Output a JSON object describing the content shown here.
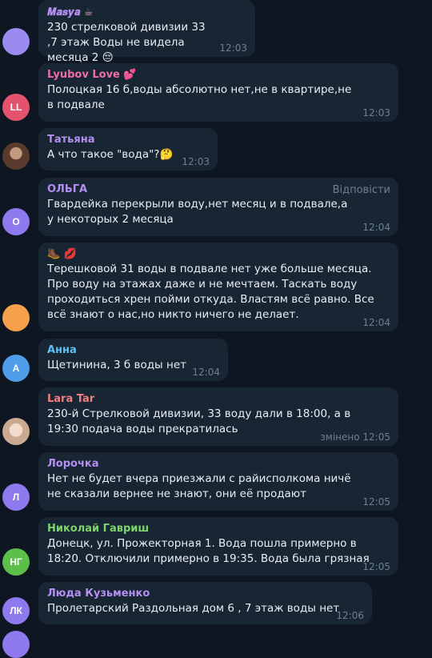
{
  "messages": [
    {
      "name": "𝑴𝒂𝒔𝒚𝒂",
      "name_emoji": "☕",
      "name_color": "#b48ef0",
      "text": "230 стрелковой дивизии 33 ,7 этаж Воды не видела месяца 2 😔",
      "time": "12:03",
      "avatar_initials": "",
      "avatar_color": "#9b8af0"
    },
    {
      "name": "Lyubov Love",
      "name_emoji": "💕",
      "name_color": "#f06ea9",
      "text": "Полоцкая 16 б,воды абсолютно нет,не в квартире,не в подвале",
      "time": "12:03",
      "avatar_initials": "LL",
      "avatar_color": "#e4526e"
    },
    {
      "name": "Татьяна",
      "name_emoji": "",
      "name_color": "#b48ef0",
      "text": "А что такое \"вода\"?🤔",
      "time": "12:03",
      "avatar_initials": "",
      "avatar_color": "#7a5a4e"
    },
    {
      "name": "ОЛЬГА",
      "name_emoji": "",
      "name_color": "#b48ef0",
      "text": "Гвардейка перекрыли воду,нет месяц и в подвале,а у некоторых 2 месяца",
      "time": "12:04",
      "reply_label": "Відповісти",
      "avatar_initials": "О",
      "avatar_color": "#8e79ee"
    },
    {
      "name": "",
      "name_emoji": "🥾 💋",
      "name_color": "#e9eef4",
      "text": "Терешковой 31 воды в подвале нет уже больше месяца. Про воду на этажах даже и не мечтаем. Таскать воду проходиться хрен пойми откуда. Властям всё равно. Все всё знают о нас,но никто ничего не делает.",
      "time": "12:04",
      "avatar_initials": "",
      "avatar_color": "#f5a04a"
    },
    {
      "name": "Анна",
      "name_emoji": "",
      "name_color": "#5ec1f5",
      "text": "Щетинина, 3 б воды нет",
      "time": "12:04",
      "avatar_initials": "А",
      "avatar_color": "#4f9de8"
    },
    {
      "name": "Lara Tar",
      "name_emoji": "",
      "name_color": "#f07f7f",
      "text": "230-й Стрелковой дивизии, 33 воду дали в 18:00, а в 19:30 подача воды прекратилась",
      "time": "змінено 12:05",
      "avatar_initials": "",
      "avatar_color": "#d9c3b3"
    },
    {
      "name": "Лорочка",
      "name_emoji": "",
      "name_color": "#b48ef0",
      "text": "Нет не будет вчера приезжали с райисполкома ничё не сказали вернее не знают, они её продают",
      "time": "12:05",
      "avatar_initials": "Л",
      "avatar_color": "#8e79ee"
    },
    {
      "name": "Николай Гавриш",
      "name_emoji": "",
      "name_color": "#7ed46c",
      "text": "Донецк, ул. Прожекторная 1. Вода пошла примерно в 18:20. Отключили примерно в 19:35. Вода была грязная",
      "time": "12:05",
      "avatar_initials": "НГ",
      "avatar_color": "#5bbf4a"
    },
    {
      "name": "Люда Кузьменко",
      "name_emoji": "",
      "name_color": "#b48ef0",
      "text": "Пролетарский Раздольная дом 6 , 7 этаж воды нет",
      "time": "12:06",
      "avatar_initials": "ЛК",
      "avatar_color": "#8e79ee"
    }
  ]
}
